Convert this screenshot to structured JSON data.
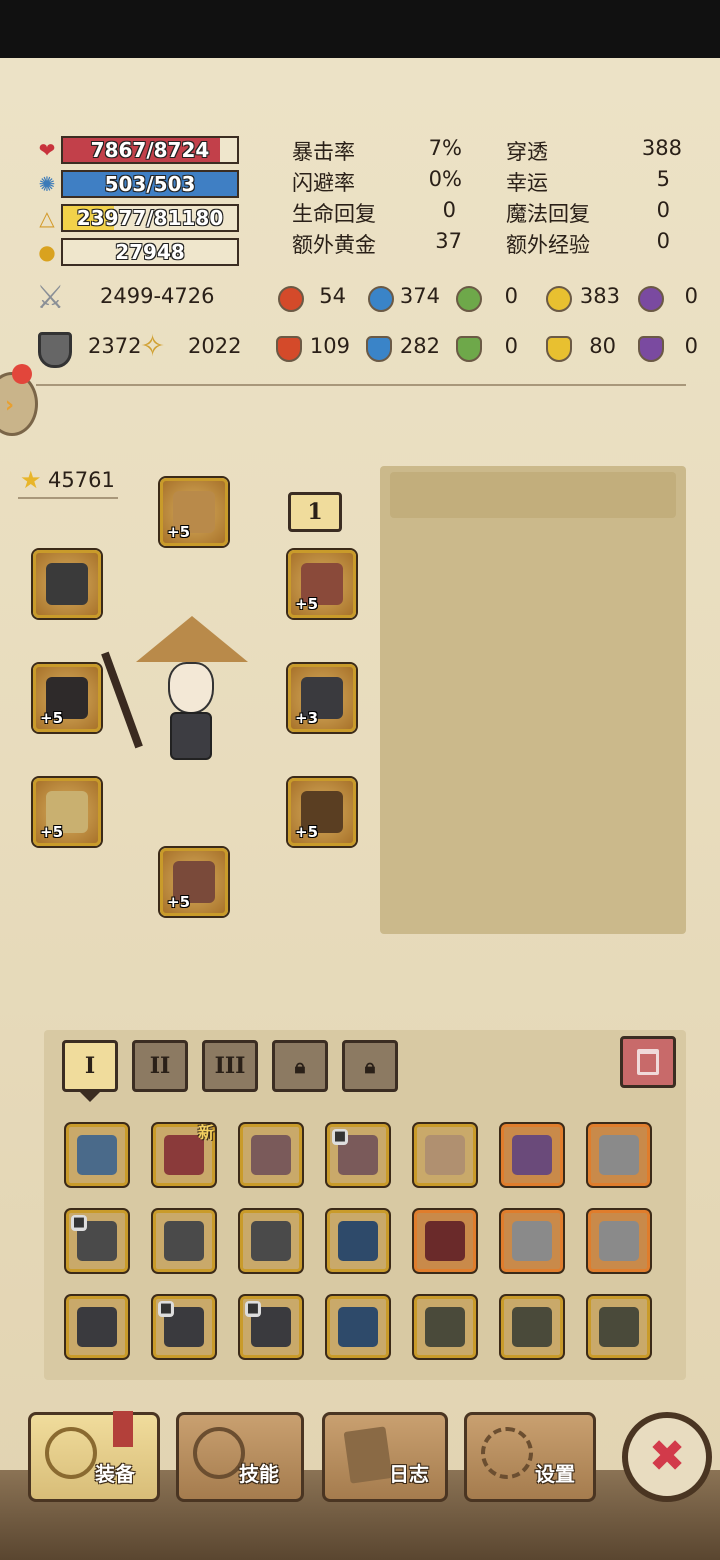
{
  "stats": {
    "hp": {
      "text": "7867/8724",
      "ratio": 0.902,
      "color": "#c2404a",
      "icon": "heart-icon"
    },
    "mp": {
      "text": "503/503",
      "ratio": 1.0,
      "color": "#3f7fc4",
      "icon": "mana-icon"
    },
    "xp": {
      "text": "23977/81180",
      "ratio": 0.295,
      "color": "#f2d24a",
      "icon": "experience-icon"
    },
    "gold": {
      "text": "27948",
      "icon": "gold-icon"
    }
  },
  "attributes": [
    {
      "label": "暴击率",
      "value": "7%",
      "label2": "穿透",
      "value2": "388"
    },
    {
      "label": "闪避率",
      "value": "0%",
      "label2": "幸运",
      "value2": "5"
    },
    {
      "label": "生命回复",
      "value": "0",
      "label2": "魔法回复",
      "value2": "0"
    },
    {
      "label": "额外黄金",
      "value": "37",
      "label2": "额外经验",
      "value2": "0"
    }
  ],
  "combat": {
    "attack": "2499-4726",
    "defense": "2372",
    "magic": "2022",
    "elem_attack": [
      "54",
      "374",
      "0",
      "383",
      "0"
    ],
    "elem_defense": [
      "109",
      "282",
      "0",
      "80",
      "0"
    ]
  },
  "power_score": "45761",
  "loadout_number": "1",
  "equipped": [
    {
      "name": "hat-slot",
      "plus": "+5"
    },
    {
      "name": "mask-slot",
      "plus": ""
    },
    {
      "name": "necklace-slot",
      "plus": "+5"
    },
    {
      "name": "weapon-slot",
      "plus": "+5"
    },
    {
      "name": "armor-slot",
      "plus": "+3"
    },
    {
      "name": "gloves-slot",
      "plus": "+5"
    },
    {
      "name": "pants-slot",
      "plus": "+5"
    },
    {
      "name": "boots-slot",
      "plus": "+5"
    }
  ],
  "inventory_tabs": [
    "I",
    "II",
    "III"
  ],
  "new_badge": "新",
  "nav": [
    {
      "label": "装备"
    },
    {
      "label": "技能"
    },
    {
      "label": "日志"
    },
    {
      "label": "设置"
    }
  ],
  "close_symbol": "✖"
}
